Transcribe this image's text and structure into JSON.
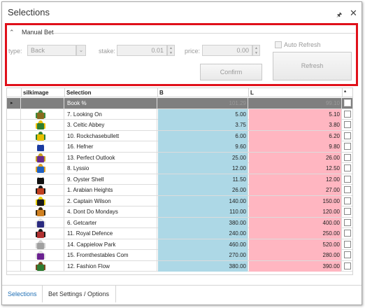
{
  "window": {
    "title": "Selections",
    "pin_icon": "pin-icon",
    "close_icon": "close-icon"
  },
  "manual_bet": {
    "group_title": "Manual Bet",
    "type_label": "type:",
    "type_value": "Back",
    "stake_label": "stake:",
    "stake_value": "0.01",
    "price_label": "price:",
    "price_value": "0.00",
    "auto_refresh_label": "Auto Refresh",
    "confirm_label": "Confirm",
    "refresh_label": "Refresh"
  },
  "grid": {
    "columns": {
      "silk": "silkimage",
      "selection": "Selection",
      "back": "B",
      "lay": "L",
      "star": "*"
    },
    "book_row": {
      "label": "Book %",
      "back": "101.29",
      "lay": "99.10"
    },
    "rows": [
      {
        "selection": "7. Looking On",
        "back": "5.00",
        "lay": "5.10"
      },
      {
        "selection": "3. Celtic Abbey",
        "back": "3.75",
        "lay": "3.80"
      },
      {
        "selection": "10. Rockchasebullett",
        "back": "6.00",
        "lay": "6.20"
      },
      {
        "selection": "16. Hefner",
        "back": "9.60",
        "lay": "9.80"
      },
      {
        "selection": "13. Perfect Outlook",
        "back": "25.00",
        "lay": "26.00"
      },
      {
        "selection": "8. Lyssio",
        "back": "12.00",
        "lay": "12.50"
      },
      {
        "selection": "9. Oyster Shell",
        "back": "11.50",
        "lay": "12.00"
      },
      {
        "selection": "1. Arabian Heights",
        "back": "26.00",
        "lay": "27.00"
      },
      {
        "selection": "2. Captain Wilson",
        "back": "140.00",
        "lay": "150.00"
      },
      {
        "selection": "4. Dont Do Mondays",
        "back": "110.00",
        "lay": "120.00"
      },
      {
        "selection": "6. Getcarter",
        "back": "380.00",
        "lay": "400.00"
      },
      {
        "selection": "11. Royal Defence",
        "back": "240.00",
        "lay": "250.00"
      },
      {
        "selection": "14. Cappielow Park",
        "back": "460.00",
        "lay": "520.00"
      },
      {
        "selection": "15. Fromthestables Com",
        "back": "270.00",
        "lay": "280.00"
      },
      {
        "selection": "12. Fashion Flow",
        "back": "380.00",
        "lay": "390.00"
      }
    ]
  },
  "tabs": [
    {
      "label": "Selections"
    },
    {
      "label": "Bet Settings / Options"
    }
  ],
  "colors": {
    "back": "#add8e6",
    "lay": "#ffb6c1",
    "highlight_border": "#e0101a",
    "active_tab": "#1f6fb5"
  }
}
